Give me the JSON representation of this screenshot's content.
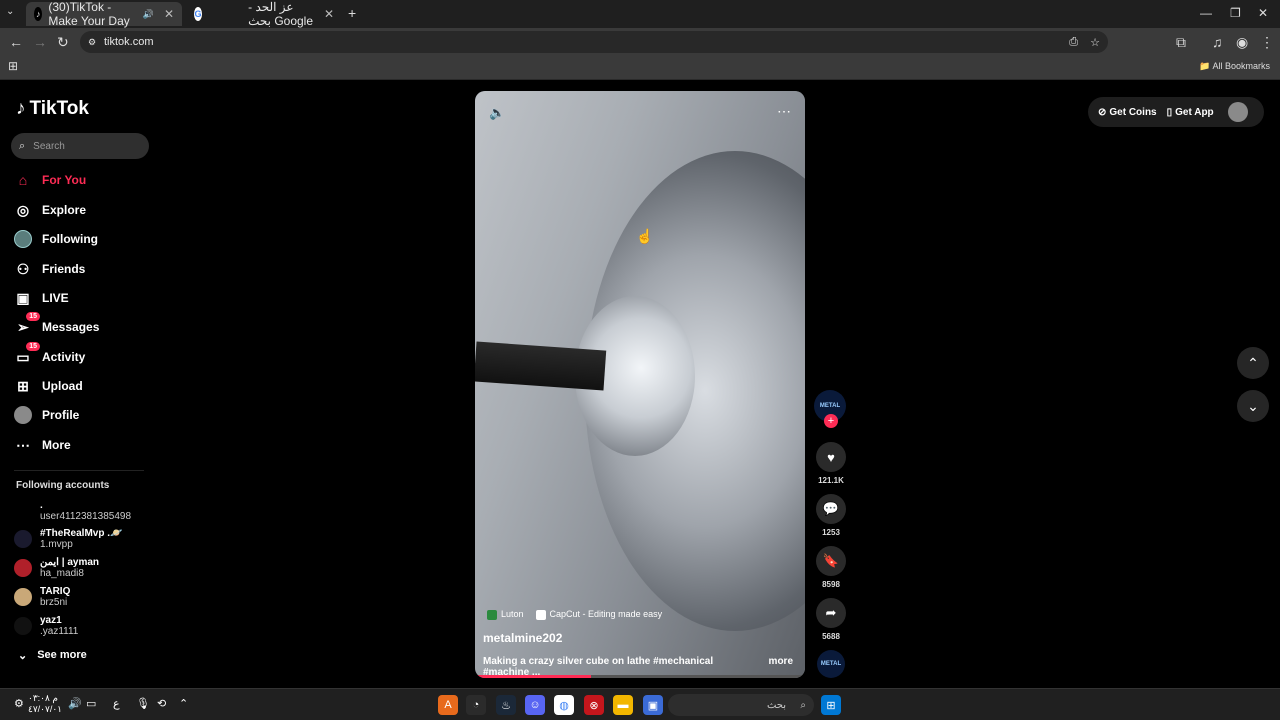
{
  "browser": {
    "tabs": [
      {
        "title": "(30)TikTok - Make Your Day",
        "active": true
      },
      {
        "title": "عز الحد - بحث Google",
        "active": false
      }
    ],
    "url": "tiktok.com",
    "all_bookmarks": "All Bookmarks"
  },
  "tiktok": {
    "logo": "TikTok",
    "search_placeholder": "Search",
    "nav": [
      {
        "label": "For You",
        "icon": "home-icon",
        "active": true
      },
      {
        "label": "Explore",
        "icon": "compass-icon"
      },
      {
        "label": "Following",
        "icon": "following-avatar-icon"
      },
      {
        "label": "Friends",
        "icon": "friends-icon"
      },
      {
        "label": "LIVE",
        "icon": "live-icon"
      },
      {
        "label": "Messages",
        "icon": "messages-icon",
        "badge": "15"
      },
      {
        "label": "Activity",
        "icon": "activity-icon",
        "badge": "15"
      },
      {
        "label": "Upload",
        "icon": "upload-icon"
      },
      {
        "label": "Profile",
        "icon": "profile-avatar-icon"
      },
      {
        "label": "More",
        "icon": "more-dots-icon"
      }
    ],
    "following_header": "Following accounts",
    "following": [
      {
        "name": ".",
        "handle": "user4112381385498"
      },
      {
        "name": "#TheRealMvp .🪐",
        "handle": "1.mvpp"
      },
      {
        "name": "ايمن | ayman",
        "handle": "ha_madi8"
      },
      {
        "name": "TARIQ",
        "handle": "brz5ni"
      },
      {
        "name": "yaz1",
        "handle": ".yaz1111"
      }
    ],
    "see_more": "See more",
    "top_right": {
      "get_coins": "Get Coins",
      "get_app": "Get App"
    },
    "video": {
      "tag1": "Luton",
      "tag2": "CapCut - Editing made easy",
      "author": "metalmine202",
      "caption": "Making a crazy silver cube on lathe #mechanical #machine ...",
      "more": "more",
      "progress": 0.35
    },
    "actions": {
      "avatar_text": "METAL",
      "likes": "121.1K",
      "comments": "1253",
      "saves": "8598",
      "shares": "5688"
    }
  },
  "taskbar": {
    "search_placeholder": "بحث",
    "time": "م ٠٣:٠٨",
    "date": "٤٧/٠٧/٠١",
    "lang": "ع"
  }
}
